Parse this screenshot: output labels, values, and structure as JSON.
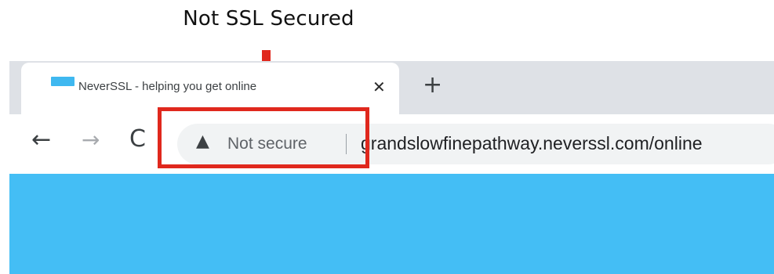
{
  "annotation": {
    "label": "Not SSL Secured",
    "color": "#e0281d"
  },
  "tab": {
    "favicon": "neverssl-favicon",
    "title": "NeverSSL - helping you get online",
    "close_glyph": "✕",
    "new_tab_glyph": "+"
  },
  "toolbar": {
    "back_glyph": "←",
    "forward_glyph": "→",
    "reload_glyph": "C"
  },
  "omnibox": {
    "security_icon": "warning-triangle-icon",
    "security_glyph": "▲",
    "security_label": "Not secure",
    "url": "grandslowfinepathway.neverssl.com/online"
  },
  "page": {
    "background_color": "#44bef5"
  }
}
